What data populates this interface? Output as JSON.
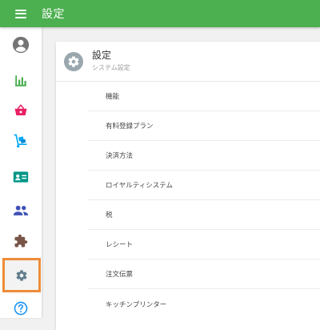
{
  "topbar": {
    "title": "設定",
    "menu_icon": "menu-icon",
    "color": "#4caf50"
  },
  "sidebar": {
    "items": [
      {
        "name": "account",
        "icon": "account-circle-icon",
        "color": "#757575"
      },
      {
        "name": "reports",
        "icon": "bar-chart-icon",
        "color": "#4caf50"
      },
      {
        "name": "shop",
        "icon": "basket-icon",
        "color": "#e91e63"
      },
      {
        "name": "delivery",
        "icon": "hand-truck-icon",
        "color": "#03a9f4"
      },
      {
        "name": "contacts",
        "icon": "contact-card-icon",
        "color": "#009688"
      },
      {
        "name": "staff",
        "icon": "people-icon",
        "color": "#3f51b5"
      },
      {
        "name": "extensions",
        "icon": "puzzle-icon",
        "color": "#795548"
      },
      {
        "name": "settings",
        "icon": "gear-icon",
        "color": "#607d8b",
        "active": true
      },
      {
        "name": "help",
        "icon": "help-circle-icon",
        "color": "#2196f3"
      }
    ],
    "active_border_color": "#ee8c3a"
  },
  "card": {
    "title": "設定",
    "subtitle": "システム設定",
    "icon": "gear-icon",
    "items": [
      {
        "label": "機能"
      },
      {
        "label": "有料登録プラン"
      },
      {
        "label": "決済方法"
      },
      {
        "label": "ロイヤルティシステム"
      },
      {
        "label": "税"
      },
      {
        "label": "レシート"
      },
      {
        "label": "注文伝票"
      },
      {
        "label": "キッチンプリンター"
      }
    ]
  }
}
